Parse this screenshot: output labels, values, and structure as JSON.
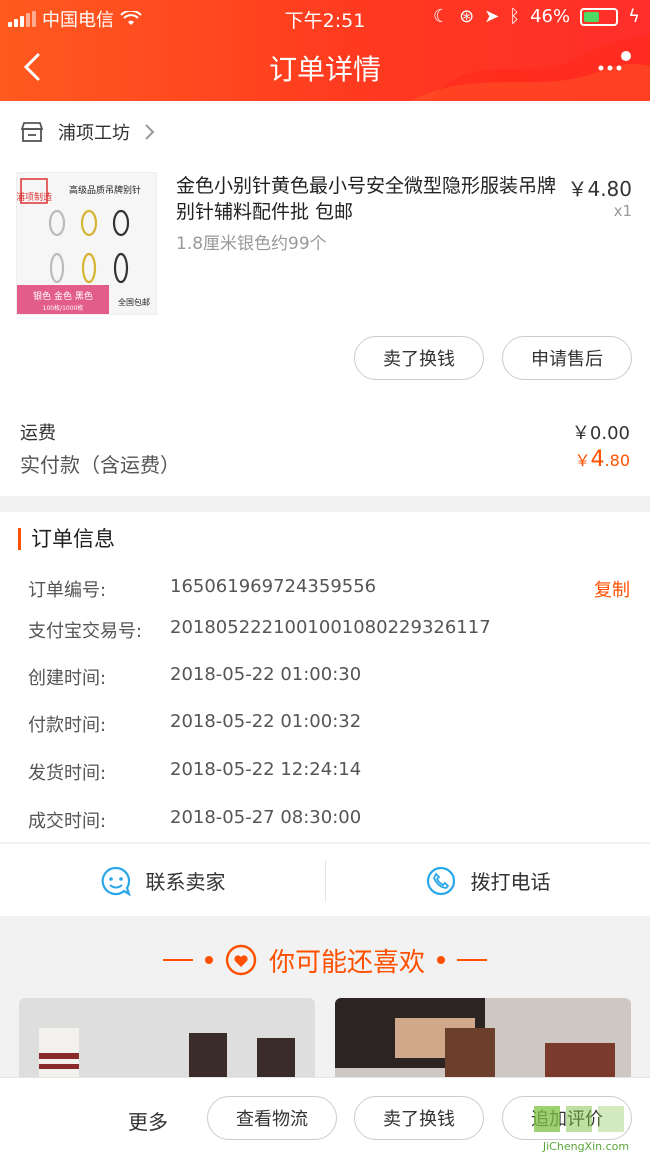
{
  "status_bar": {
    "carrier": "中国电信",
    "time": "下午2:51",
    "battery": "46%"
  },
  "nav": {
    "title": "订单详情"
  },
  "shop": {
    "name": "浦项工坊",
    "item": {
      "title": "金色小别针黄色最小号安全微型隐形服装吊牌别针辅料配件批 包邮",
      "spec": "1.8厘米银色约99个",
      "price": "￥4.80",
      "qty": "x1",
      "image_text": {
        "stamp": "浦项制造",
        "heading": "高级品质吊牌别针",
        "colors": "银色  金色  黑色",
        "amount": "100枚/1000枚",
        "free_ship": "全国包邮"
      }
    },
    "buttons": {
      "sell": "卖了换钱",
      "after_sale": "申请售后"
    },
    "shipping_label": "运费",
    "shipping_value": "￥0.00",
    "paid_label": "实付款（含运费）",
    "paid_currency": "￥",
    "paid_int": "4",
    "paid_dec": ".80"
  },
  "order_info": {
    "title": "订单信息",
    "copy_label": "复制",
    "rows": [
      {
        "label": "订单编号:",
        "value": "165061969724359556"
      },
      {
        "label": "支付宝交易号:",
        "value": "2018052221001001080229326117"
      },
      {
        "label": "创建时间:",
        "value": "2018-05-22 01:00:30"
      },
      {
        "label": "付款时间:",
        "value": "2018-05-22 01:00:32"
      },
      {
        "label": "发货时间:",
        "value": "2018-05-22 12:24:14"
      },
      {
        "label": "成交时间:",
        "value": "2018-05-27 08:30:00"
      }
    ]
  },
  "contact": {
    "seller": "联系卖家",
    "phone": "拨打电话"
  },
  "recommend": {
    "title": "你可能还喜欢"
  },
  "bottom_bar": {
    "more": "更多",
    "logistics": "查看物流",
    "sell": "卖了换钱",
    "review": "追加评价"
  },
  "watermark": {
    "site": "JiChengXin.com"
  },
  "colors": {
    "accent": "#ff5000",
    "header": "#ff3a1f"
  }
}
